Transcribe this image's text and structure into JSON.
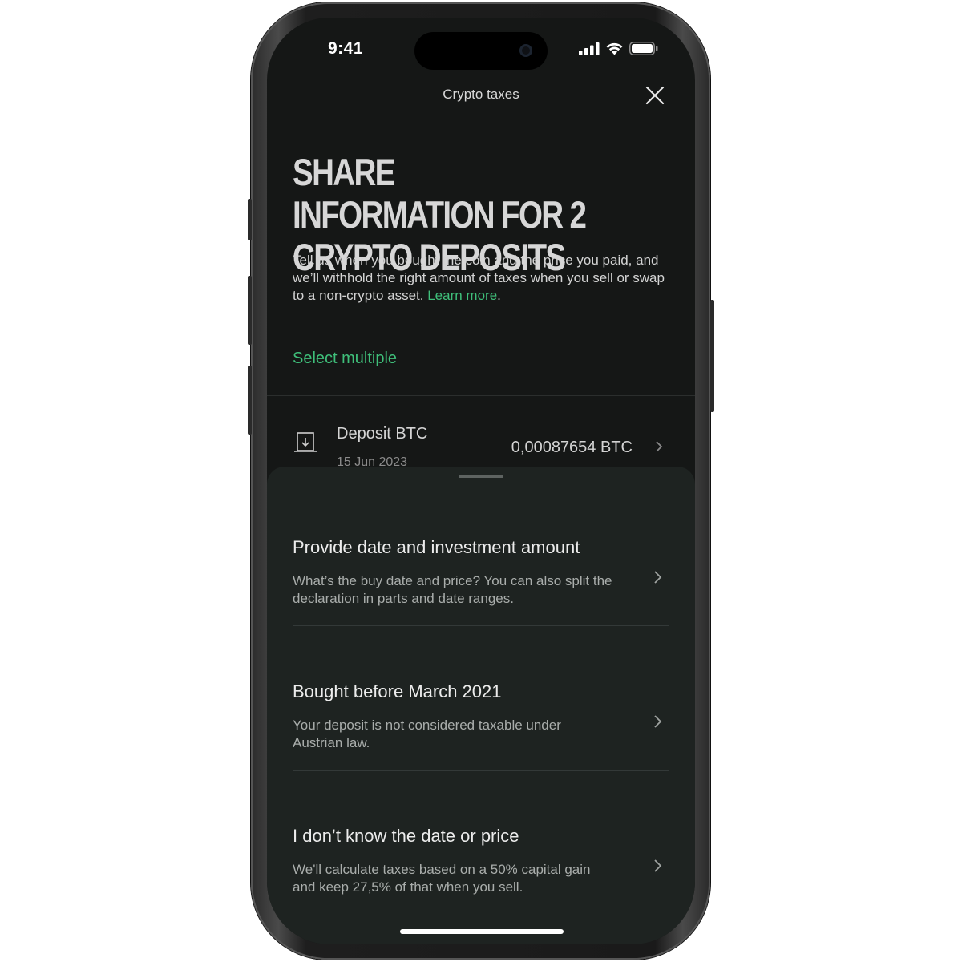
{
  "status_bar": {
    "time": "9:41"
  },
  "header": {
    "title": "Crypto taxes"
  },
  "headline": "SHARE INFORMATION FOR 2 CRYPTO DEPOSITS",
  "intro": {
    "text": "Tell us when you bought the coin and the price you paid, and we’ll withhold the right amount of taxes when you sell or swap to a non-crypto asset.",
    "link_label": "Learn more",
    "trailing": "."
  },
  "select_multiple_label": "Select multiple",
  "deposit": {
    "name": "Deposit BTC",
    "date": "15 Jun 2023",
    "amount": "0,00087654 BTC"
  },
  "sheet": {
    "options": [
      {
        "title": "Provide date and investment amount",
        "description": "What’s the buy date and price? You can also split the declaration in parts and date ranges."
      },
      {
        "title": "Bought before March 2021",
        "description": "Your deposit is not considered taxable under Austrian law."
      },
      {
        "title": "I don’t know the date or price",
        "description": "We'll calculate taxes based on a 50% capital gain and keep 27,5% of that when you sell."
      }
    ]
  },
  "colors": {
    "accent": "#3fbf7a",
    "background": "#151716",
    "sheet": "#1e2321"
  }
}
